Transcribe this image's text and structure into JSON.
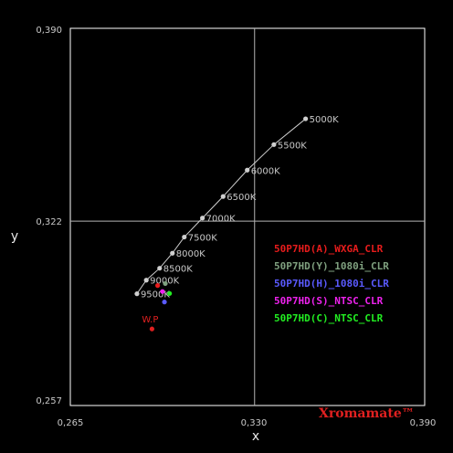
{
  "chart_data": {
    "type": "scatter",
    "xlabel": "x",
    "ylabel": "y",
    "xlim": [
      0.265,
      0.39
    ],
    "ylim": [
      0.257,
      0.39
    ],
    "x_ticks": [
      "0,265",
      "0,330",
      "0,390"
    ],
    "y_ticks": [
      "0,257",
      "0,322",
      "0,390"
    ],
    "grid_x": 0.33,
    "grid_y": 0.322,
    "brand": "Xromamate™",
    "colors": {
      "frame": "#ffffff",
      "grid": "#b4b4b4",
      "locus": "#cfcfcf",
      "white_point": "#e02020"
    },
    "blackbody_locus": {
      "points": [
        {
          "x": 0.348,
          "y": 0.3581,
          "label": "5000K"
        },
        {
          "x": 0.3368,
          "y": 0.349,
          "label": "5500K"
        },
        {
          "x": 0.3274,
          "y": 0.34,
          "label": "6000K"
        },
        {
          "x": 0.3189,
          "y": 0.3307,
          "label": "6500K"
        },
        {
          "x": 0.3116,
          "y": 0.3231,
          "label": "7000K"
        },
        {
          "x": 0.3052,
          "y": 0.3164,
          "label": "7500K"
        },
        {
          "x": 0.301,
          "y": 0.3107,
          "label": "8000K"
        },
        {
          "x": 0.2965,
          "y": 0.3054,
          "label": "8500K"
        },
        {
          "x": 0.2918,
          "y": 0.3012,
          "label": "9000K"
        },
        {
          "x": 0.2885,
          "y": 0.2964,
          "label": "9500K"
        }
      ]
    },
    "white_point": {
      "x": 0.2938,
      "y": 0.284,
      "label": "W.P"
    },
    "series": [
      {
        "name": "50P7HD(A)_WXGA_CLR",
        "color": "#e81c1c",
        "x": 0.2958,
        "y": 0.2993
      },
      {
        "name": "50P7HD(Y)_1080i_CLR",
        "color": "#7fa07f",
        "x": 0.2985,
        "y": 0.3
      },
      {
        "name": "50P7HD(H)_1080i_CLR",
        "color": "#5a5aff",
        "x": 0.2982,
        "y": 0.2935
      },
      {
        "name": "50P7HD(S)_NTSC_CLR",
        "color": "#ee22ee",
        "x": 0.2975,
        "y": 0.2972
      },
      {
        "name": "50P7HD(C)_NTSC_CLR",
        "color": "#22ee22",
        "x": 0.3,
        "y": 0.2965
      }
    ]
  }
}
